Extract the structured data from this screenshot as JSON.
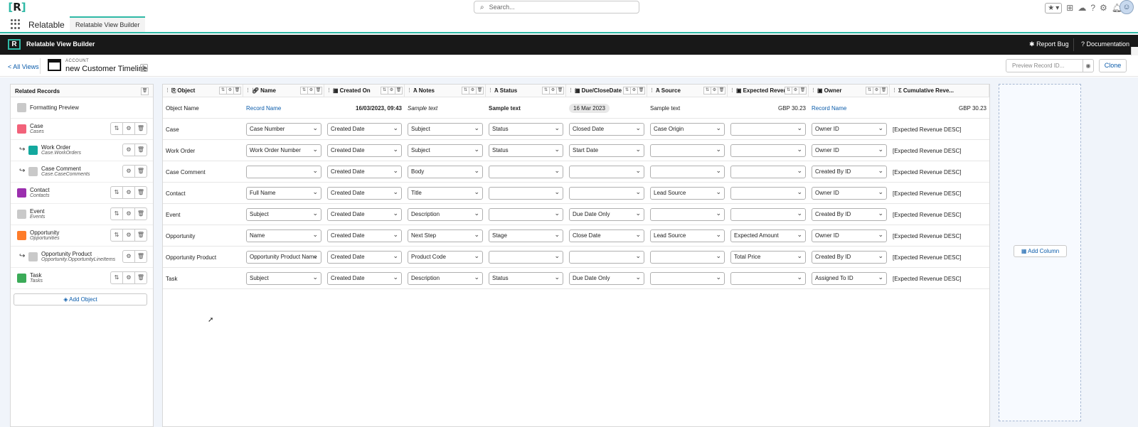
{
  "topbar": {
    "logo": "R",
    "search_placeholder": "Search..."
  },
  "appbar": {
    "app_name": "Relatable",
    "tab_label": "Relatable View Builder"
  },
  "builder_bar": {
    "title": "Relatable View Builder",
    "report_bug": "Report Bug",
    "documentation": "Documentation"
  },
  "view": {
    "back_link": "< All Views",
    "object_label": "ACCOUNT",
    "title": "new Customer Timeline",
    "preview_placeholder": "Preview Record ID...",
    "clone_label": "Clone"
  },
  "related": {
    "header": "Related Records",
    "add_object": "Add Object",
    "items": [
      {
        "name": "Formatting Preview",
        "api": "",
        "color": "#c9c9c9"
      },
      {
        "name": "Case",
        "api": "Cases",
        "color": "#f2627a"
      },
      {
        "name": "Work Order",
        "api": "Case.WorkOrders",
        "color": "#13a89e"
      },
      {
        "name": "Case Comment",
        "api": "Case.CaseComments",
        "color": "#c9c9c9"
      },
      {
        "name": "Contact",
        "api": "Contacts",
        "color": "#9b2fae"
      },
      {
        "name": "Event",
        "api": "Events",
        "color": "#c9c9c9"
      },
      {
        "name": "Opportunity",
        "api": "Opportunities",
        "color": "#fe7c2a"
      },
      {
        "name": "Opportunity Product",
        "api": "Opportunity.OpportunityLineItems",
        "color": "#c9c9c9"
      },
      {
        "name": "Task",
        "api": "Tasks",
        "color": "#3bab58"
      }
    ]
  },
  "columns": [
    "Object",
    "Name",
    "Created On",
    "Notes",
    "Status",
    "Due/CloseDate",
    "Source",
    "Expected Reven",
    "Owner",
    "Cumulative Reve..."
  ],
  "preview_row": [
    "Object Name",
    "Record Name",
    "16/03/2023, 09:43",
    "Sample text",
    "Sample text",
    "16 Mar 2023",
    "Sample text",
    "GBP 30.23",
    "Record Name",
    "GBP 30.23"
  ],
  "rows": [
    {
      "object": "Case",
      "cells": [
        "Case Number",
        "Created Date",
        "Subject",
        "Status",
        "Closed Date",
        "Case Origin",
        "",
        "Owner ID"
      ],
      "cumulative": "[Expected Revenue DESC]"
    },
    {
      "object": "Work Order",
      "cells": [
        "Work Order Number",
        "Created Date",
        "Subject",
        "Status",
        "Start Date",
        "",
        "",
        "Owner ID"
      ],
      "cumulative": "[Expected Revenue DESC]"
    },
    {
      "object": "Case Comment",
      "cells": [
        "",
        "Created Date",
        "Body",
        "",
        "",
        "",
        "",
        "Created By ID"
      ],
      "cumulative": "[Expected Revenue DESC]"
    },
    {
      "object": "Contact",
      "cells": [
        "Full Name",
        "Created Date",
        "Title",
        "",
        "",
        "Lead Source",
        "",
        "Owner ID"
      ],
      "cumulative": "[Expected Revenue DESC]"
    },
    {
      "object": "Event",
      "cells": [
        "Subject",
        "Created Date",
        "Description",
        "",
        "Due Date Only",
        "",
        "",
        "Created By ID"
      ],
      "cumulative": "[Expected Revenue DESC]"
    },
    {
      "object": "Opportunity",
      "cells": [
        "Name",
        "Created Date",
        "Next Step",
        "Stage",
        "Close Date",
        "Lead Source",
        "Expected Amount",
        "Owner ID"
      ],
      "cumulative": "[Expected Revenue DESC]"
    },
    {
      "object": "Opportunity Product",
      "cells": [
        "Opportunity Product Name",
        "Created Date",
        "Product Code",
        "",
        "",
        "",
        "Total Price",
        "Created By ID"
      ],
      "cumulative": "[Expected Revenue DESC]"
    },
    {
      "object": "Task",
      "cells": [
        "Subject",
        "Created Date",
        "Description",
        "Status",
        "Due Date Only",
        "",
        "",
        "Assigned To ID"
      ],
      "cumulative": "[Expected Revenue DESC]"
    }
  ],
  "add_column": "Add Column"
}
